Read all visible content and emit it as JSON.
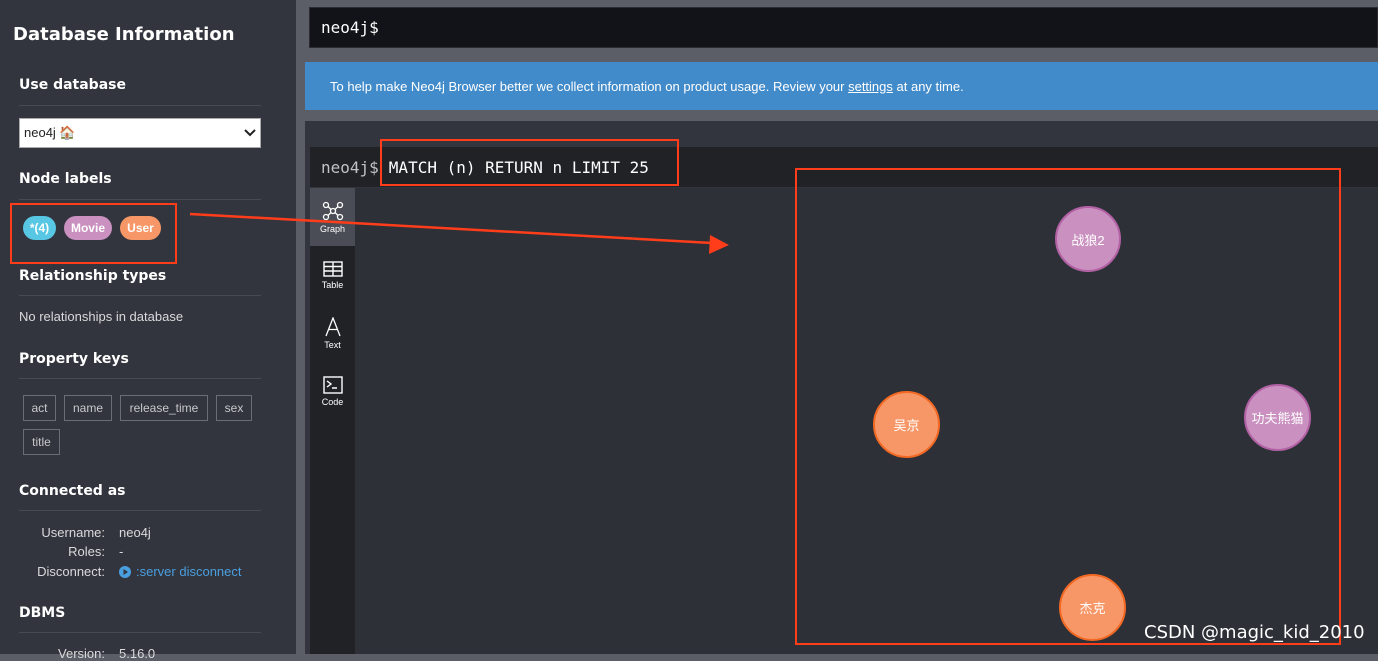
{
  "sidebar": {
    "title": "Database Information",
    "use_database": {
      "heading": "Use database",
      "selected": "neo4j 🏠"
    },
    "node_labels": {
      "heading": "Node labels",
      "items": [
        {
          "label": "*(4)",
          "color": "#57c7e3"
        },
        {
          "label": "Movie",
          "color": "#c990c0"
        },
        {
          "label": "User",
          "color": "#f79767"
        }
      ]
    },
    "relationship_types": {
      "heading": "Relationship types",
      "empty_text": "No relationships in database"
    },
    "property_keys": {
      "heading": "Property keys",
      "items": [
        "act",
        "name",
        "release_time",
        "sex",
        "title"
      ]
    },
    "connected_as": {
      "heading": "Connected as",
      "username_label": "Username:",
      "username_value": "neo4j",
      "roles_label": "Roles:",
      "roles_value": "-",
      "disconnect_label": "Disconnect:",
      "disconnect_link": ":server disconnect"
    },
    "dbms": {
      "heading": "DBMS",
      "version_label": "Version:",
      "version_value": "5.16.0"
    }
  },
  "editor": {
    "prompt": "neo4j$"
  },
  "banner": {
    "text_before": "To help make Neo4j Browser better we collect information on product usage. Review your ",
    "link": "settings",
    "text_after": " at any time."
  },
  "result_frame": {
    "prompt": "neo4j$",
    "query": "MATCH (n) RETURN n LIMIT 25",
    "views": [
      {
        "label": "Graph",
        "icon": "graph-icon",
        "active": true
      },
      {
        "label": "Table",
        "icon": "table-icon",
        "active": false
      },
      {
        "label": "Text",
        "icon": "text-icon",
        "active": false
      },
      {
        "label": "Code",
        "icon": "code-icon",
        "active": false
      }
    ],
    "nodes": [
      {
        "label": "战狼2",
        "type": "Movie"
      },
      {
        "label": "吴京",
        "type": "User"
      },
      {
        "label": "功夫熊猫",
        "type": "Movie"
      },
      {
        "label": "杰克",
        "type": "User"
      }
    ]
  },
  "watermark": "CSDN @magic_kid_2010",
  "colors": {
    "annotation_red": "#ff3d1a",
    "banner_blue": "#428bca",
    "movie": "#c990c0",
    "user": "#f79767",
    "all": "#57c7e3"
  }
}
